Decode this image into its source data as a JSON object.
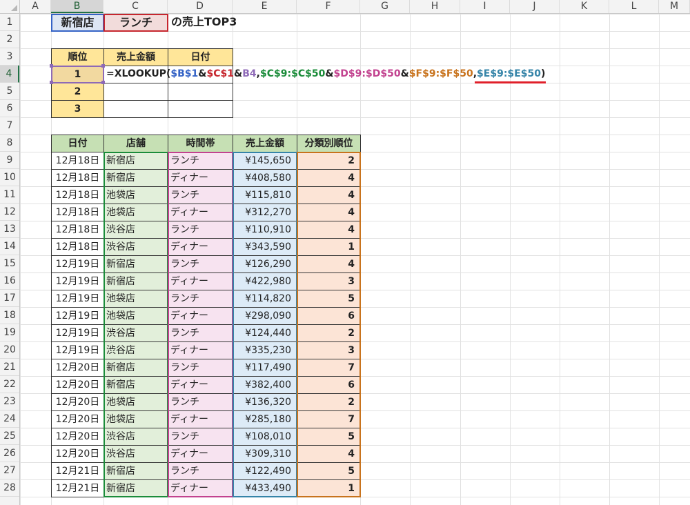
{
  "columns": [
    "A",
    "B",
    "C",
    "D",
    "E",
    "F",
    "G",
    "H",
    "I",
    "J",
    "K",
    "L",
    "M"
  ],
  "selected_column": "B",
  "rows": [
    "1",
    "2",
    "3",
    "4",
    "5",
    "6",
    "7",
    "8",
    "9",
    "10",
    "11",
    "12",
    "13",
    "14",
    "15",
    "16",
    "17",
    "18",
    "19",
    "20",
    "21",
    "22",
    "23",
    "24",
    "25",
    "26",
    "27",
    "28"
  ],
  "selected_row": "4",
  "title": {
    "store": "新宿店",
    "timeslot": "ランチ",
    "suffix": "の売上TOP3"
  },
  "top3": {
    "headers": [
      "順位",
      "売上金額",
      "日付"
    ],
    "ranks": [
      "1",
      "2",
      "3"
    ]
  },
  "formula_tokens": [
    {
      "text": "=XLOOKUP(",
      "cls": ""
    },
    {
      "text": "$B$1",
      "cls": "tok-b"
    },
    {
      "text": "&",
      "cls": ""
    },
    {
      "text": "$C$1",
      "cls": "tok-c"
    },
    {
      "text": "&",
      "cls": ""
    },
    {
      "text": "B4",
      "cls": "tok-b4"
    },
    {
      "text": ",",
      "cls": ""
    },
    {
      "text": "$C$9:$C$50",
      "cls": "tok-cc"
    },
    {
      "text": "&",
      "cls": ""
    },
    {
      "text": "$D$9:$D$50",
      "cls": "tok-dd"
    },
    {
      "text": "&",
      "cls": ""
    },
    {
      "text": "$F$9:$F$50",
      "cls": "tok-ff"
    },
    {
      "text": ",",
      "cls": ""
    },
    {
      "text": "$E$9:$E$50",
      "cls": "tok-ee"
    },
    {
      "text": ")",
      "cls": ""
    }
  ],
  "data_table": {
    "headers": [
      "日付",
      "店舗",
      "時間帯",
      "売上金額",
      "分類別順位"
    ],
    "rows": [
      [
        "12月18日",
        "新宿店",
        "ランチ",
        "¥145,650",
        "2"
      ],
      [
        "12月18日",
        "新宿店",
        "ディナー",
        "¥408,580",
        "4"
      ],
      [
        "12月18日",
        "池袋店",
        "ランチ",
        "¥115,810",
        "4"
      ],
      [
        "12月18日",
        "池袋店",
        "ディナー",
        "¥312,270",
        "4"
      ],
      [
        "12月18日",
        "渋谷店",
        "ランチ",
        "¥110,910",
        "4"
      ],
      [
        "12月18日",
        "渋谷店",
        "ディナー",
        "¥343,590",
        "1"
      ],
      [
        "12月19日",
        "新宿店",
        "ランチ",
        "¥126,290",
        "4"
      ],
      [
        "12月19日",
        "新宿店",
        "ディナー",
        "¥422,980",
        "3"
      ],
      [
        "12月19日",
        "池袋店",
        "ランチ",
        "¥114,820",
        "5"
      ],
      [
        "12月19日",
        "池袋店",
        "ディナー",
        "¥298,090",
        "6"
      ],
      [
        "12月19日",
        "渋谷店",
        "ランチ",
        "¥124,440",
        "2"
      ],
      [
        "12月19日",
        "渋谷店",
        "ディナー",
        "¥335,230",
        "3"
      ],
      [
        "12月20日",
        "新宿店",
        "ランチ",
        "¥117,490",
        "7"
      ],
      [
        "12月20日",
        "新宿店",
        "ディナー",
        "¥382,400",
        "6"
      ],
      [
        "12月20日",
        "池袋店",
        "ランチ",
        "¥136,320",
        "2"
      ],
      [
        "12月20日",
        "池袋店",
        "ディナー",
        "¥285,180",
        "7"
      ],
      [
        "12月20日",
        "渋谷店",
        "ランチ",
        "¥108,010",
        "5"
      ],
      [
        "12月20日",
        "渋谷店",
        "ディナー",
        "¥309,310",
        "4"
      ],
      [
        "12月21日",
        "新宿店",
        "ランチ",
        "¥122,490",
        "5"
      ],
      [
        "12月21日",
        "新宿店",
        "ディナー",
        "¥433,490",
        "1"
      ]
    ]
  },
  "colors": {
    "header_green": "#c6e0b4",
    "header_gold": "#ffe699",
    "rank_selected": "#f2d9a0",
    "col_c_fill": "#e2efda",
    "col_d_fill": "#f7e3f0",
    "col_e_fill": "#ddebf7",
    "col_f_fill": "#fce4d6",
    "b1_fill": "#dde6f4",
    "c1_fill": "#f2dcdb"
  }
}
